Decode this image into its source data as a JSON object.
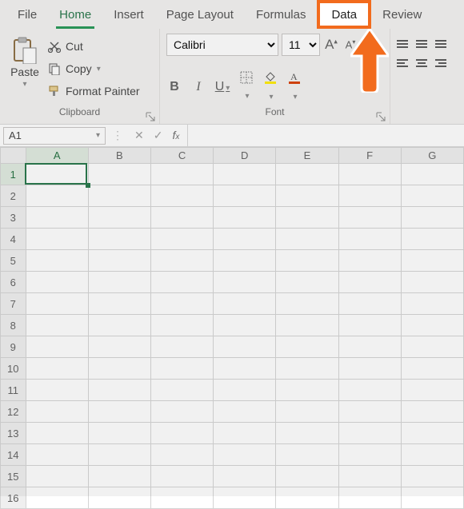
{
  "tabs": {
    "file": "File",
    "home": "Home",
    "insert": "Insert",
    "pagelayout": "Page Layout",
    "formulas": "Formulas",
    "data": "Data",
    "review": "Review"
  },
  "clipboard": {
    "paste": "Paste",
    "cut": "Cut",
    "copy": "Copy",
    "format_painter": "Format Painter",
    "group_label": "Clipboard"
  },
  "font": {
    "name": "Calibri",
    "size": "11",
    "group_label": "Font"
  },
  "namebox": "A1",
  "columns": [
    "A",
    "B",
    "C",
    "D",
    "E",
    "F",
    "G"
  ],
  "rows": [
    "1",
    "2",
    "3",
    "4",
    "5",
    "6",
    "7",
    "8",
    "9",
    "10",
    "11",
    "12",
    "13",
    "14",
    "15",
    "16"
  ]
}
